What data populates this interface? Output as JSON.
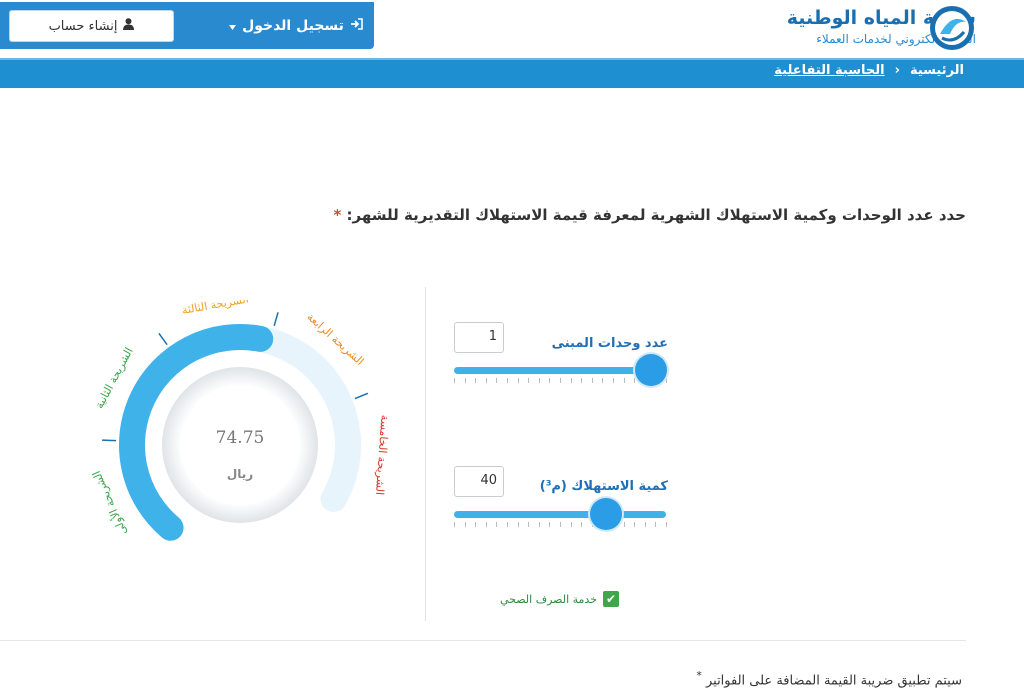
{
  "header": {
    "logo_title": "شركة المياه الوطنية",
    "logo_subtitle": "الفرع الالكتروني لخدمات العملاء",
    "login_label": "تسجيل الدخول",
    "register_label": "إنشاء حساب"
  },
  "breadcrumb": {
    "home": "الرئيسية",
    "separator": "›",
    "current": "الحاسبة التفاعلية"
  },
  "prompt": {
    "text": "حدد عدد الوحدات وكمية الاستهلاك الشهرية لمعرفة قيمة الاستهلاك التقديرية للشهر:",
    "required_mark": "*"
  },
  "units": {
    "label": "عدد وحدات المبنى",
    "value": "1",
    "slider_fraction": 1.0
  },
  "consumption": {
    "label": "كمية الاستهلاك (م³)",
    "value": "40",
    "slider_fraction": 0.75
  },
  "health_service": {
    "label": "خدمة الصرف الصحي",
    "checked": true
  },
  "gauge": {
    "value": "74.75",
    "unit": "ريال",
    "fill_fraction": 0.58,
    "bands": [
      {
        "label": "الشريحة الأولى",
        "color": "#3aa64a"
      },
      {
        "label": "الشريحة الثانية",
        "color": "#3aa64a"
      },
      {
        "label": "الشريحة الثالثة",
        "color": "#f0a020"
      },
      {
        "label": "الشريحة الرابعة",
        "color": "#f08a20"
      },
      {
        "label": "الشريحة الخامسة",
        "color": "#d93a2a"
      }
    ]
  },
  "note": {
    "star": "*",
    "text": "سيتم تطبيق ضريبة القيمة المضافة على الفواتير"
  },
  "colors": {
    "primary": "#2a8ad0",
    "accent": "#3fb2ea",
    "checkbox": "#3fa74a"
  }
}
